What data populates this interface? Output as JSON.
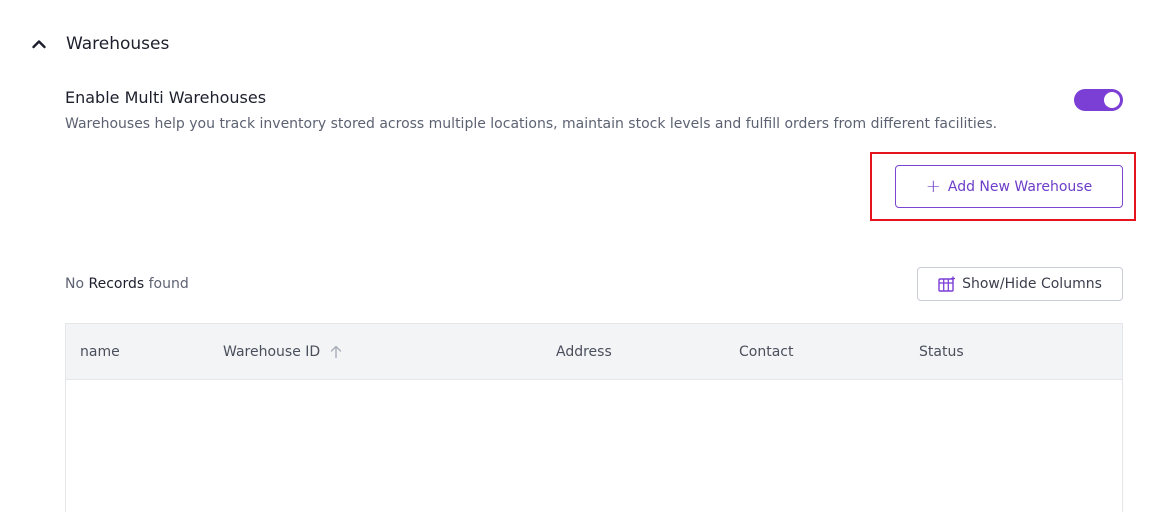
{
  "section": {
    "title": "Warehouses",
    "expanded": true
  },
  "setting": {
    "title": "Enable Multi Warehouses",
    "description": "Warehouses help you track inventory stored across multiple locations, maintain stock levels and fulfill orders from different facilities.",
    "enabled": true,
    "accent_color": "#7c3fd6"
  },
  "actions": {
    "add_label": "Add New Warehouse",
    "add_icon": "plus-icon",
    "columns_label": "Show/Hide Columns",
    "columns_icon": "columns-icon"
  },
  "records": {
    "prefix": "No",
    "strong": "Records",
    "suffix": "found"
  },
  "table": {
    "columns": [
      "name",
      "Warehouse ID",
      "Address",
      "Contact",
      "Status"
    ],
    "sort_column": "Warehouse ID",
    "sort_direction": "ascending",
    "rows": []
  },
  "highlight_color": "#e5131b"
}
